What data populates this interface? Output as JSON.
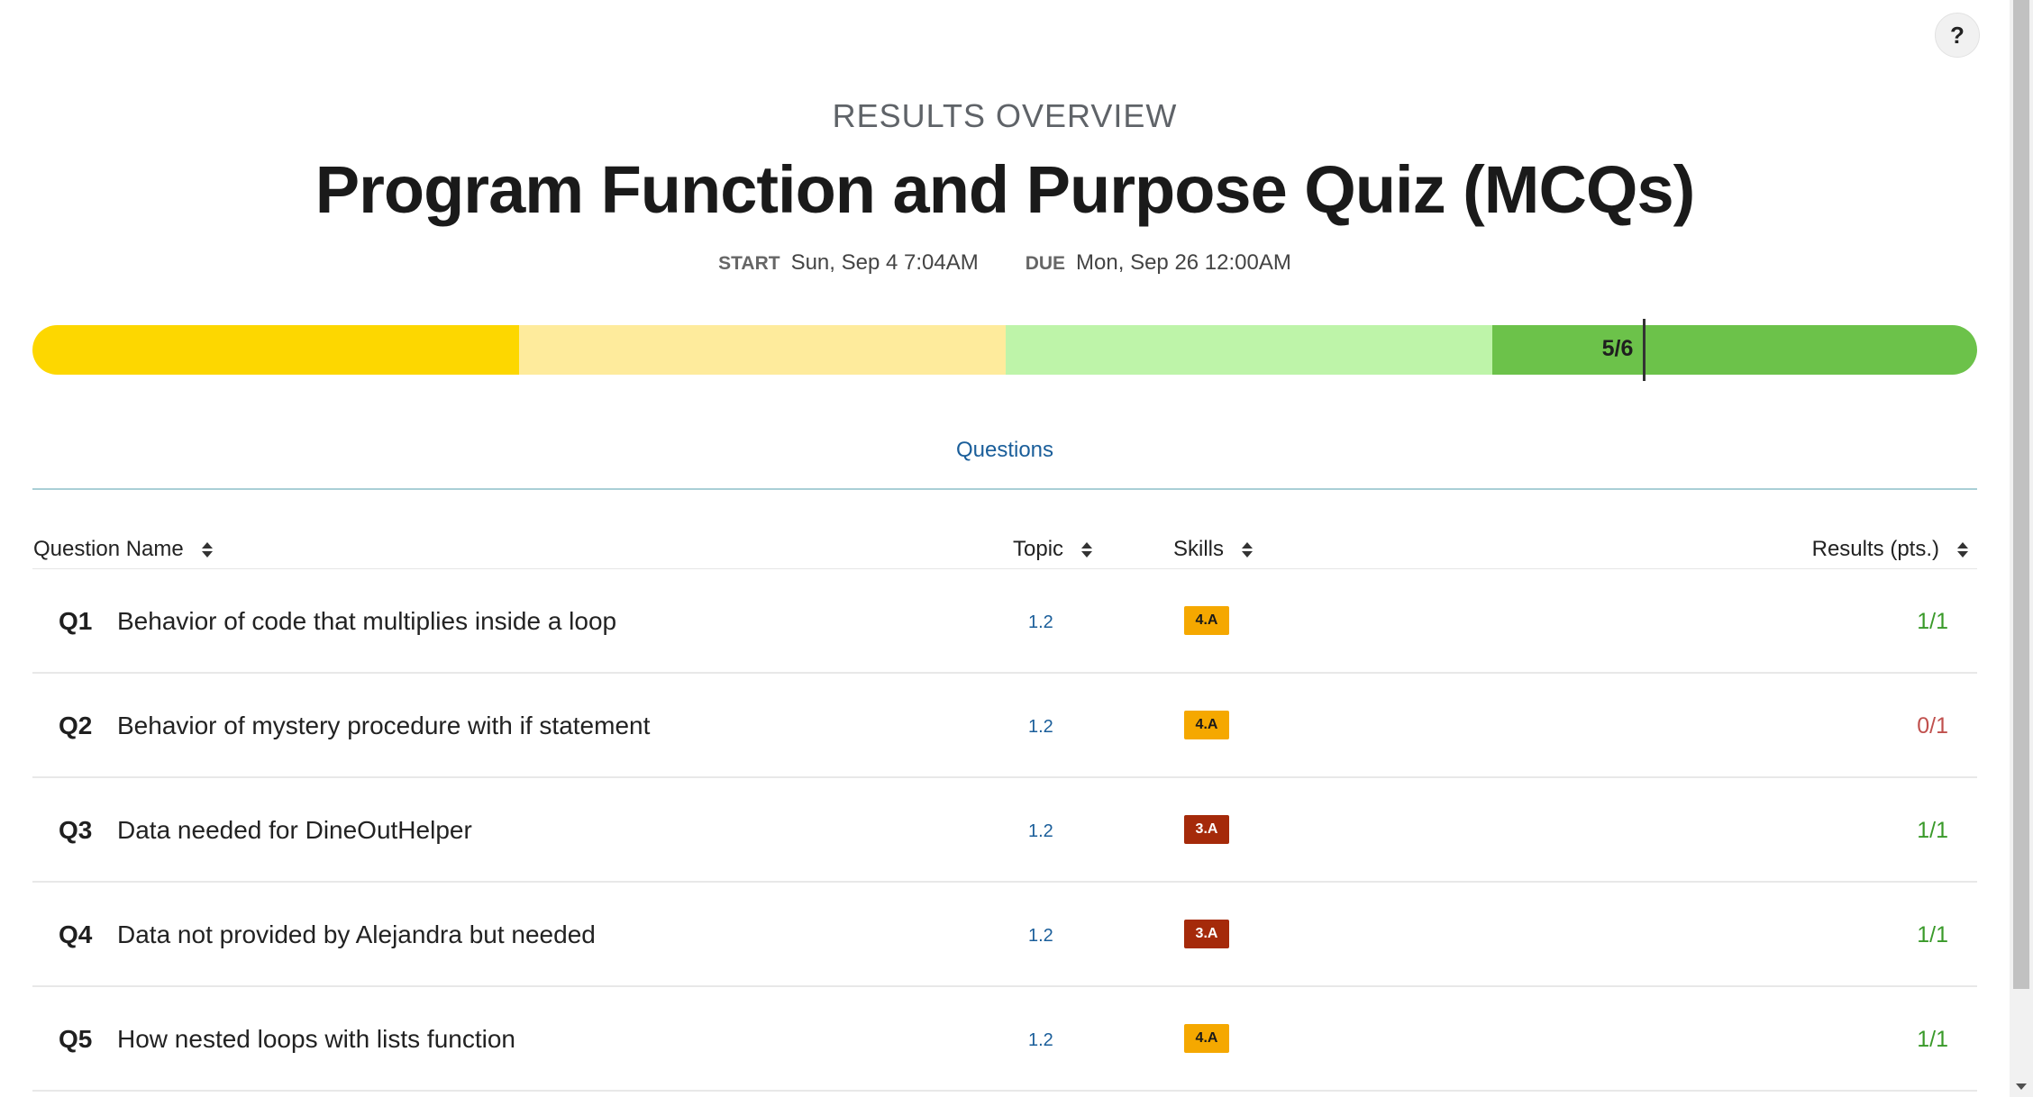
{
  "help_label": "?",
  "header": {
    "subtitle": "RESULTS OVERVIEW",
    "title": "Program Function and Purpose Quiz (MCQs)",
    "start_label": "START",
    "start_value": "Sun, Sep 4 7:04AM",
    "due_label": "DUE",
    "due_value": "Mon, Sep 26 12:00AM"
  },
  "progress": {
    "score": "5/6",
    "score_fraction": 0.833,
    "segment_colors": [
      "#fdd700",
      "#feeb9c",
      "#bef4a9",
      "#6cc24a"
    ]
  },
  "tabs": {
    "questions": "Questions"
  },
  "table": {
    "headers": {
      "name": "Question Name",
      "topic": "Topic",
      "skills": "Skills",
      "results": "Results (pts.)"
    },
    "rows": [
      {
        "num": "Q1",
        "name": "Behavior of code that multiplies inside a loop",
        "topic": "1.2",
        "skill": "4.A",
        "result": "1/1"
      },
      {
        "num": "Q2",
        "name": "Behavior of mystery procedure with if statement",
        "topic": "1.2",
        "skill": "4.A",
        "result": "0/1"
      },
      {
        "num": "Q3",
        "name": "Data needed for DineOutHelper",
        "topic": "1.2",
        "skill": "3.A",
        "result": "1/1"
      },
      {
        "num": "Q4",
        "name": "Data not provided by Alejandra but needed",
        "topic": "1.2",
        "skill": "3.A",
        "result": "1/1"
      },
      {
        "num": "Q5",
        "name": "How nested loops with lists function",
        "topic": "1.2",
        "skill": "4.A",
        "result": "1/1"
      }
    ]
  },
  "colors": {
    "skill_4A_bg": "#f5a800",
    "skill_3A_bg": "#a52a0a",
    "skill_3A_text": "#ffffff",
    "result_correct": "#3a9a2a",
    "result_incorrect": "#c0504d",
    "link": "#1a5e9a"
  }
}
